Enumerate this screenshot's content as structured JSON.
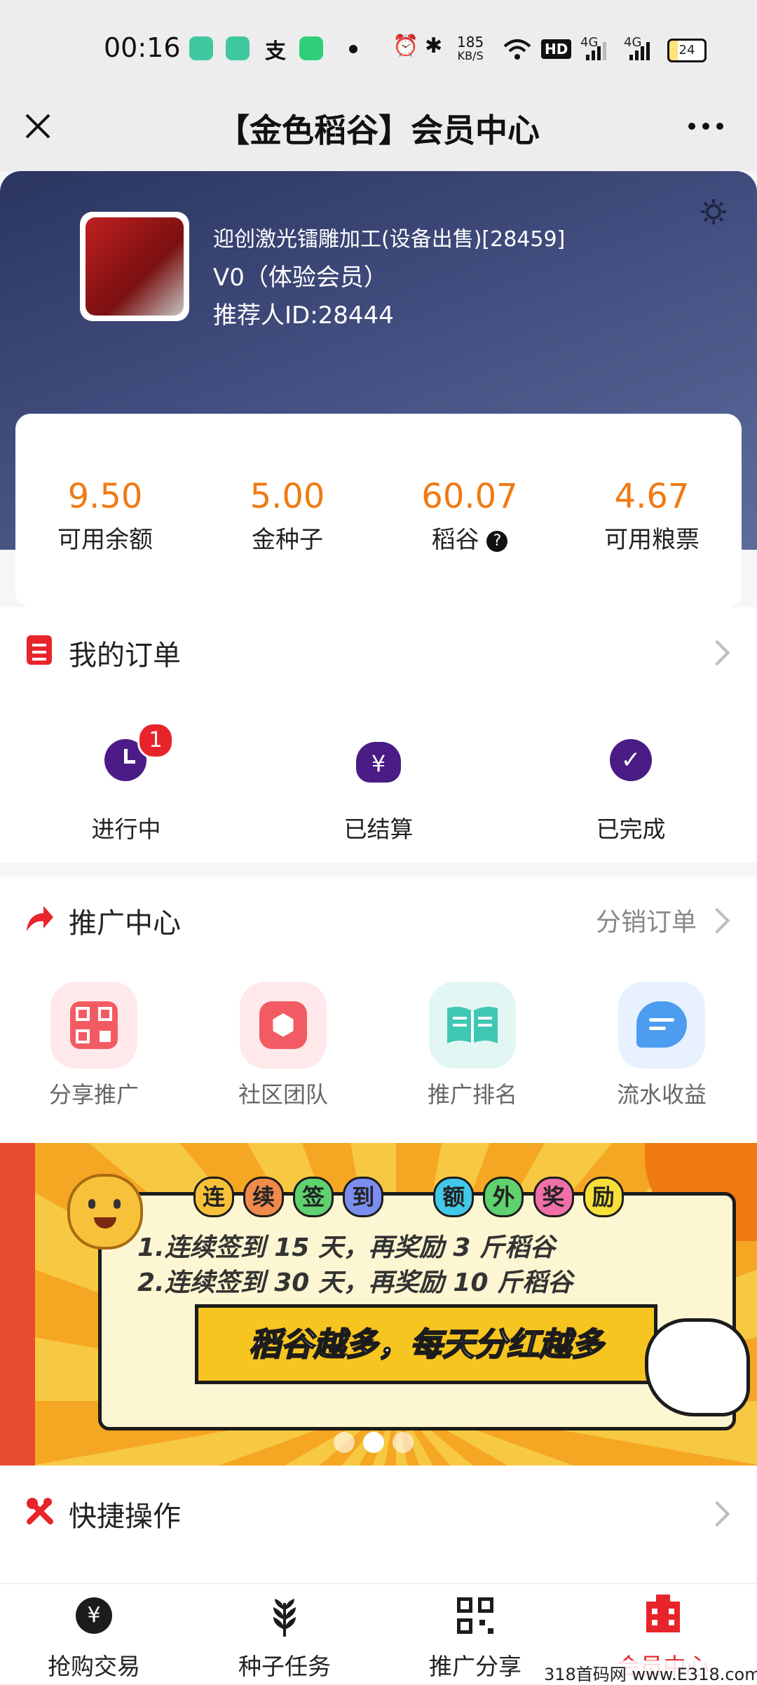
{
  "status_bar": {
    "time": "00:16",
    "net_speed_top": "185",
    "net_speed_unit": "KB/S",
    "hd": "HD",
    "sim1": "4G",
    "sim2": "4G",
    "battery": "24"
  },
  "nav": {
    "title": "【金色稻谷】会员中心"
  },
  "profile": {
    "name": "迎创激光镭雕加工(设备出售)[28459]",
    "level": "V0（体验会员）",
    "referrer": "推荐人ID:28444"
  },
  "stats": [
    {
      "value": "9.50",
      "label": "可用余额"
    },
    {
      "value": "5.00",
      "label": "金种子"
    },
    {
      "value": "60.07",
      "label": "稻谷"
    },
    {
      "value": "4.67",
      "label": "可用粮票"
    }
  ],
  "orders": {
    "title": "我的订单",
    "items": [
      {
        "label": "进行中",
        "badge": "1"
      },
      {
        "label": "已结算"
      },
      {
        "label": "已完成"
      }
    ]
  },
  "promotion": {
    "title": "推广中心",
    "link": "分销订单",
    "items": [
      {
        "label": "分享推广"
      },
      {
        "label": "社区团队"
      },
      {
        "label": "推广排名"
      },
      {
        "label": "流水收益"
      }
    ]
  },
  "banner": {
    "headline_chars": [
      "连",
      "续",
      "签",
      "到",
      "额",
      "外",
      "奖",
      "励"
    ],
    "line1": "1.连续签到 15 天，再奖励 3 斤稻谷",
    "line2": "2.连续签到 30 天，再奖励 10 斤稻谷",
    "slogan": "稻谷越多，每天分红越多"
  },
  "quick": {
    "title": "快捷操作"
  },
  "tabs": [
    {
      "label": "抢购交易"
    },
    {
      "label": "种子任务"
    },
    {
      "label": "推广分享"
    },
    {
      "label": "会员中心"
    }
  ],
  "watermark": "318首码网 www.E318.com",
  "colors": {
    "accent": "#f07a12",
    "brand_red": "#e8242b",
    "active_tab": "#e8242b",
    "icon_purple": "#4b1b86"
  }
}
